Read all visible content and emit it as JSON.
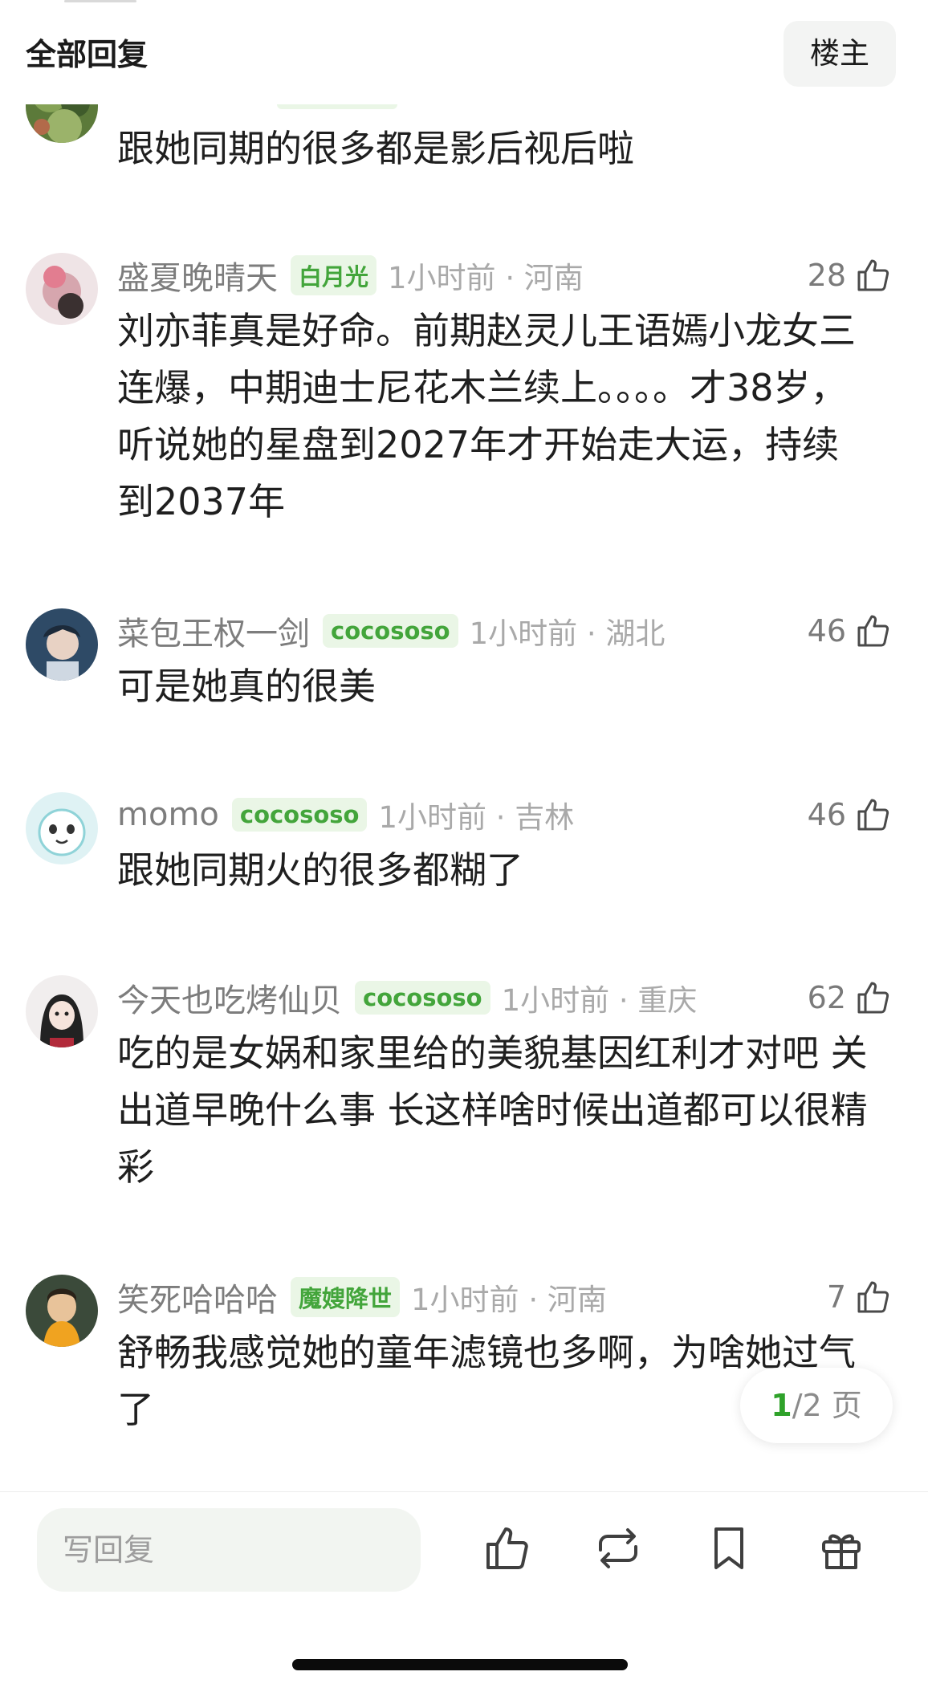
{
  "header": {
    "title": "全部回复",
    "owner_button": "楼主"
  },
  "partial_comment": {
    "text": "跟她同期的很多都是影后视后啦"
  },
  "comments": [
    {
      "username": "盛夏晚晴天",
      "badge": "白月光",
      "time": "1小时前 · 河南",
      "likes": "28",
      "text": "刘亦菲真是好命。前期赵灵儿王语嫣小龙女三连爆，中期迪士尼花木兰续上。。。。才38岁，听说她的星盘到2027年才开始走大运，持续到2037年"
    },
    {
      "username": "菜包王权一剑",
      "badge": "cocososo",
      "time": "1小时前 · 湖北",
      "likes": "46",
      "text": "可是她真的很美"
    },
    {
      "username": "momo",
      "badge": "cocososo",
      "time": "1小时前 · 吉林",
      "likes": "46",
      "text": "跟她同期火的很多都糊了"
    },
    {
      "username": "今天也吃烤仙贝",
      "badge": "cocososo",
      "time": "1小时前 · 重庆",
      "likes": "62",
      "text": "吃的是女娲和家里给的美貌基因红利才对吧 关出道早晚什么事 长这样啥时候出道都可以很精彩"
    },
    {
      "username": "笑死哈哈哈",
      "badge": "魔嫂降世",
      "time": "1小时前 · 河南",
      "likes": "7",
      "text": "舒畅我感觉她的童年滤镜也多啊，为啥她过气了"
    }
  ],
  "pagination": {
    "current": "1",
    "total_text": "/2 页"
  },
  "bottom_bar": {
    "reply_placeholder": "写回复"
  },
  "icons": {
    "like": "thumbs-up-icon",
    "repost": "repost-icon",
    "bookmark": "bookmark-icon",
    "gift": "gift-icon"
  },
  "colors": {
    "accent_green": "#43a53b",
    "badge_bg": "#eaf6e6",
    "meta_gray": "#a9a9a9"
  }
}
